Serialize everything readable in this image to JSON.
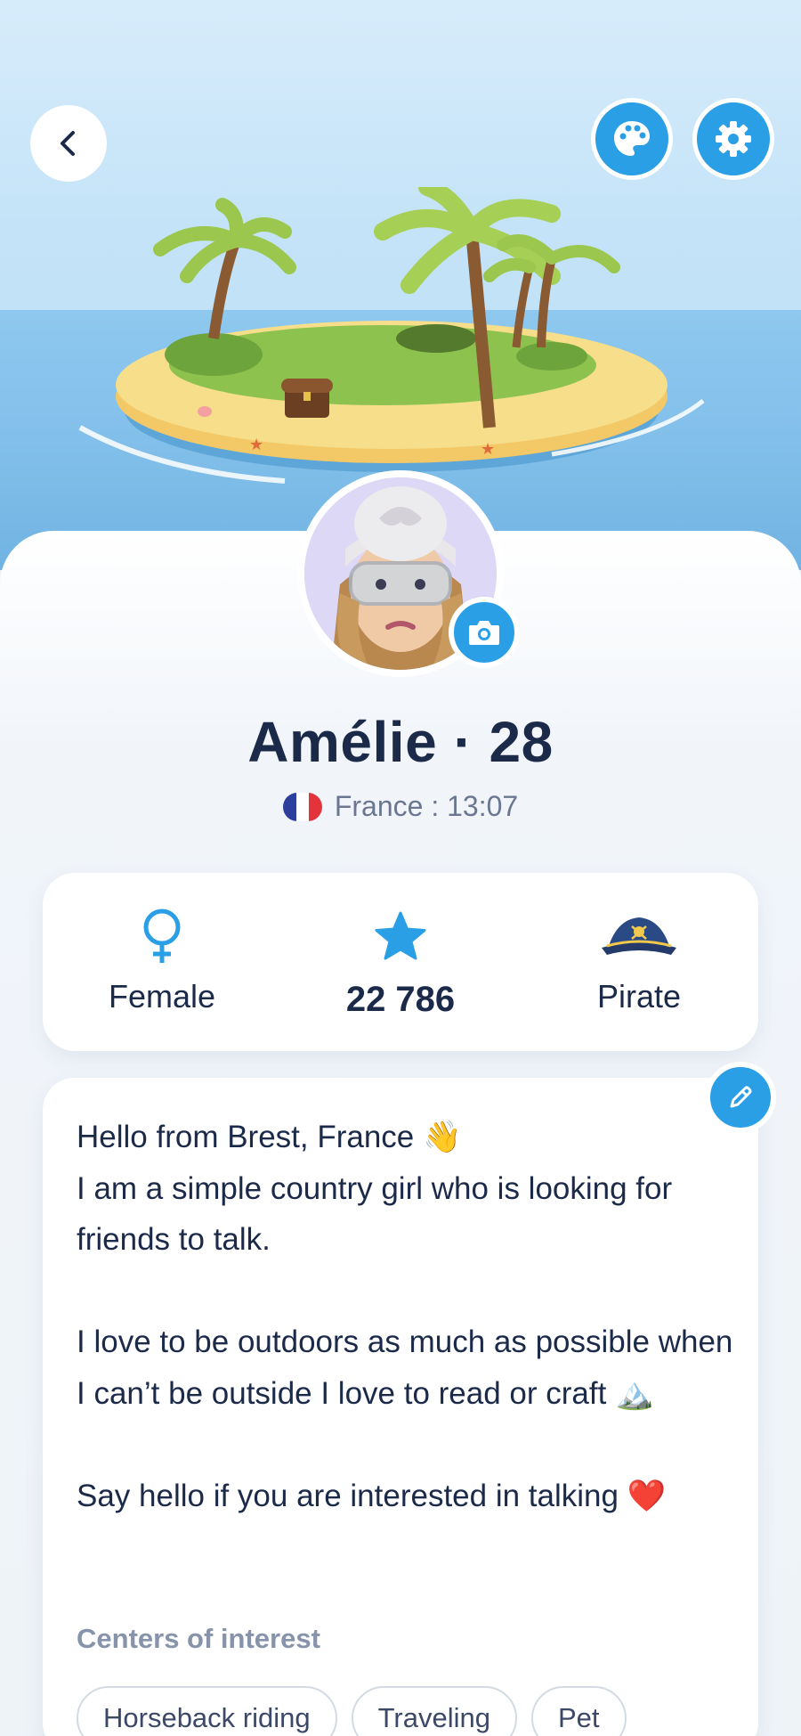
{
  "header": {
    "back_icon": "chevron-left-icon",
    "theme_icon": "palette-icon",
    "settings_icon": "gear-icon",
    "accent_color": "#2a9fe5"
  },
  "profile": {
    "name_age": "Amélie · 28",
    "country": "France",
    "local_time": "France : 13:07",
    "flag": "france-flag"
  },
  "stats": {
    "gender": {
      "icon": "female-icon",
      "label": "Female"
    },
    "points": {
      "icon": "star-icon",
      "value": "22 786"
    },
    "rank": {
      "icon": "pirate-hat-icon",
      "label": "Pirate"
    }
  },
  "bio": {
    "text": "Hello from Brest, France 👋\nI am a simple country girl who is looking for friends to talk.\n\nI love to be outdoors as much as possible when I can’t be outside I love to read or craft 🏔️\n\nSay hello if you are interested in talking ❤️"
  },
  "interests": {
    "heading": "Centers of interest",
    "items": [
      "Horseback riding",
      "Traveling",
      "Pet"
    ]
  }
}
